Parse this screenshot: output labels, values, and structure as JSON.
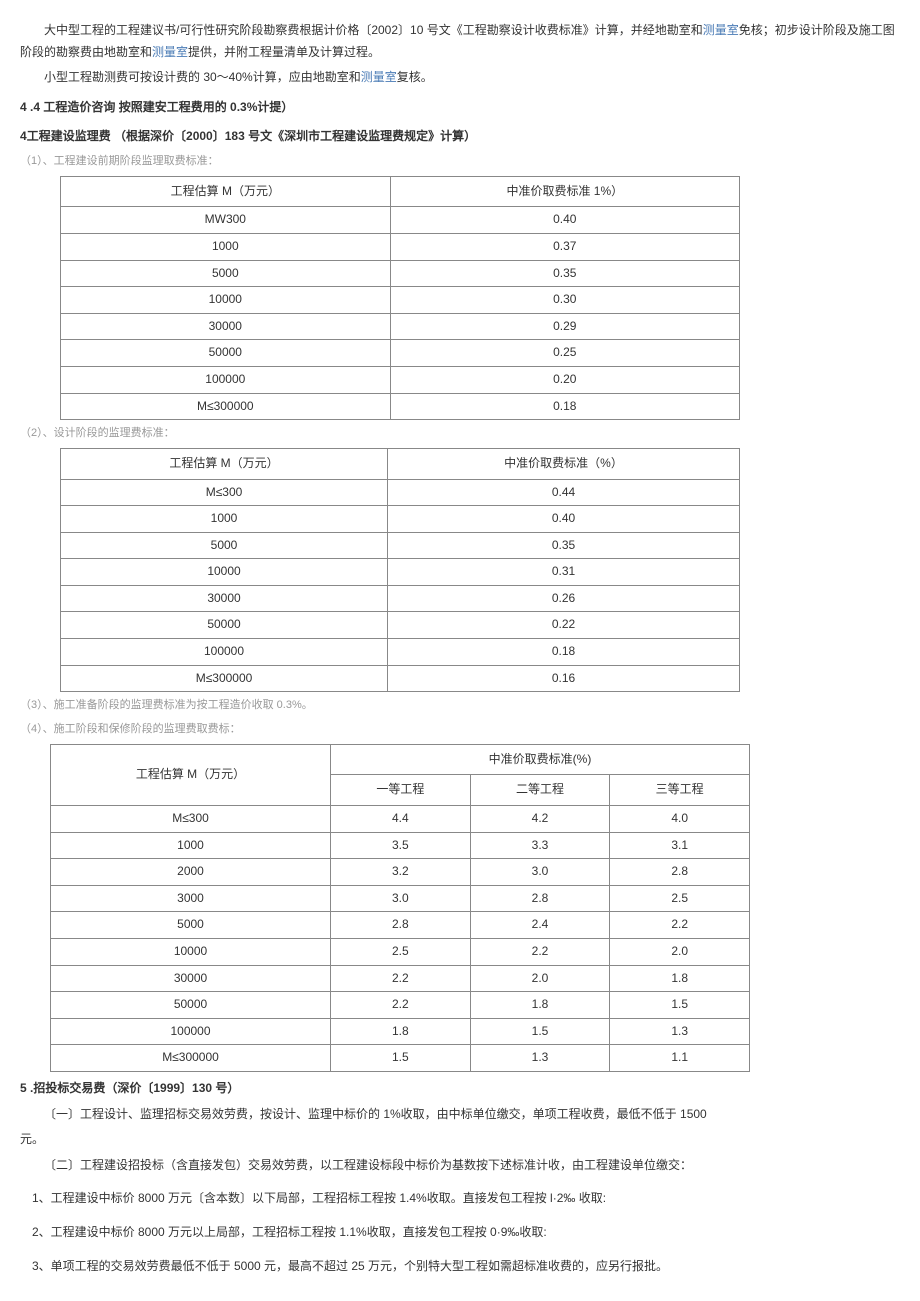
{
  "p1_a": "大中型工程的工程建议书/可行性研究阶段勘察费根据计价格〔2002〕10 号文《工程勘察设计收费标准》计算，并经地勘室和",
  "p1_b": "测量室",
  "p1_c": "免核；初步设计阶段及施工图阶段的勘察费由地勘室和",
  "p1_d": "测量室",
  "p1_e": "提供，并附工程量清单及计算过程。",
  "p2_a": "小型工程勘测费可按设计费的 30～40%计算，应由地勘室和",
  "p2_b": "测量室",
  "p2_c": "复核。",
  "h44_num": "4",
  "h44_text": " .4 工程造价咨询  按照建安工程费用的 0.3%计提）",
  "h45_num": "4",
  "h45_text": "工程建设监理费 （根据深价〔2000〕183 号文《深圳市工程建设监理费规定》计算）",
  "cap1": "（1）、工程建设前期阶段监理取费标准：",
  "t1": {
    "h1": "工程估算 M（万元）",
    "h2": "中准价取费标准 1%）",
    "rows": [
      [
        "MW300",
        "0.40"
      ],
      [
        "1000",
        "0.37"
      ],
      [
        "5000",
        "0.35"
      ],
      [
        "10000",
        "0.30"
      ],
      [
        "30000",
        "0.29"
      ],
      [
        "50000",
        "0.25"
      ],
      [
        "100000",
        "0.20"
      ],
      [
        "M≤300000",
        "0.18"
      ]
    ]
  },
  "cap2": "（2）、设计阶段的监理费标准：",
  "t2": {
    "h1": "工程估算 M（万元）",
    "h2": "中准价取费标准（%）",
    "rows": [
      [
        "M≤300",
        "0.44"
      ],
      [
        "1000",
        "0.40"
      ],
      [
        "5000",
        "0.35"
      ],
      [
        "10000",
        "0.31"
      ],
      [
        "30000",
        "0.26"
      ],
      [
        "50000",
        "0.22"
      ],
      [
        "100000",
        "0.18"
      ],
      [
        "M≤300000",
        "0.16"
      ]
    ]
  },
  "cap3": "（3）、施工准备阶段的监理费标准为按工程造价收取 0.3%。",
  "cap4": "（4）、施工阶段和保修阶段的监理费取费标：",
  "t3": {
    "h1": "工程估算 M（万元）",
    "h2": "中准价取费标准(%)",
    "sh1": "一等工程",
    "sh2": "二等工程",
    "sh3": "三等工程",
    "rows": [
      [
        "M≤300",
        "4.4",
        "4.2",
        "4.0"
      ],
      [
        "1000",
        "3.5",
        "3.3",
        "3.1"
      ],
      [
        "2000",
        "3.2",
        "3.0",
        "2.8"
      ],
      [
        "3000",
        "3.0",
        "2.8",
        "2.5"
      ],
      [
        "5000",
        "2.8",
        "2.4",
        "2.2"
      ],
      [
        "10000",
        "2.5",
        "2.2",
        "2.0"
      ],
      [
        "30000",
        "2.2",
        "2.0",
        "1.8"
      ],
      [
        "50000",
        "2.2",
        "1.8",
        "1.5"
      ],
      [
        "100000",
        "1.8",
        "1.5",
        "1.3"
      ],
      [
        "M≤300000",
        "1.5",
        "1.3",
        "1.1"
      ]
    ]
  },
  "h5_num": "5",
  "h5_text": " .招投标交易费（深价〔1999〕130 号）",
  "p5_1a": "〔一〕工程设计、监理招标交易效劳费，按设计、监理中标价的 1%收取，由中标单位缴交，单项工程收费，最低不低于 1500",
  "p5_1b": "元。",
  "p5_2": "〔二〕工程建设招投标（含直接发包）交易效劳费，以工程建设标段中标价为基数按下述标准计收，由工程建设单位缴交：",
  "p5_3": "1、工程建设中标价 8000 万元〔含本数〕以下局部，工程招标工程按 1.4%收取。直接发包工程按 l·2‰ 收取:",
  "p5_4": "2、工程建设中标价 8000 万元以上局部，工程招标工程按 1.1%收取，直接发包工程按 0·9‰收取:",
  "p5_5": "3、单项工程的交易效劳费最低不低于 5000 元，最高不超过 25 万元，个别特大型工程如需超标准收费的，应另行报批。"
}
